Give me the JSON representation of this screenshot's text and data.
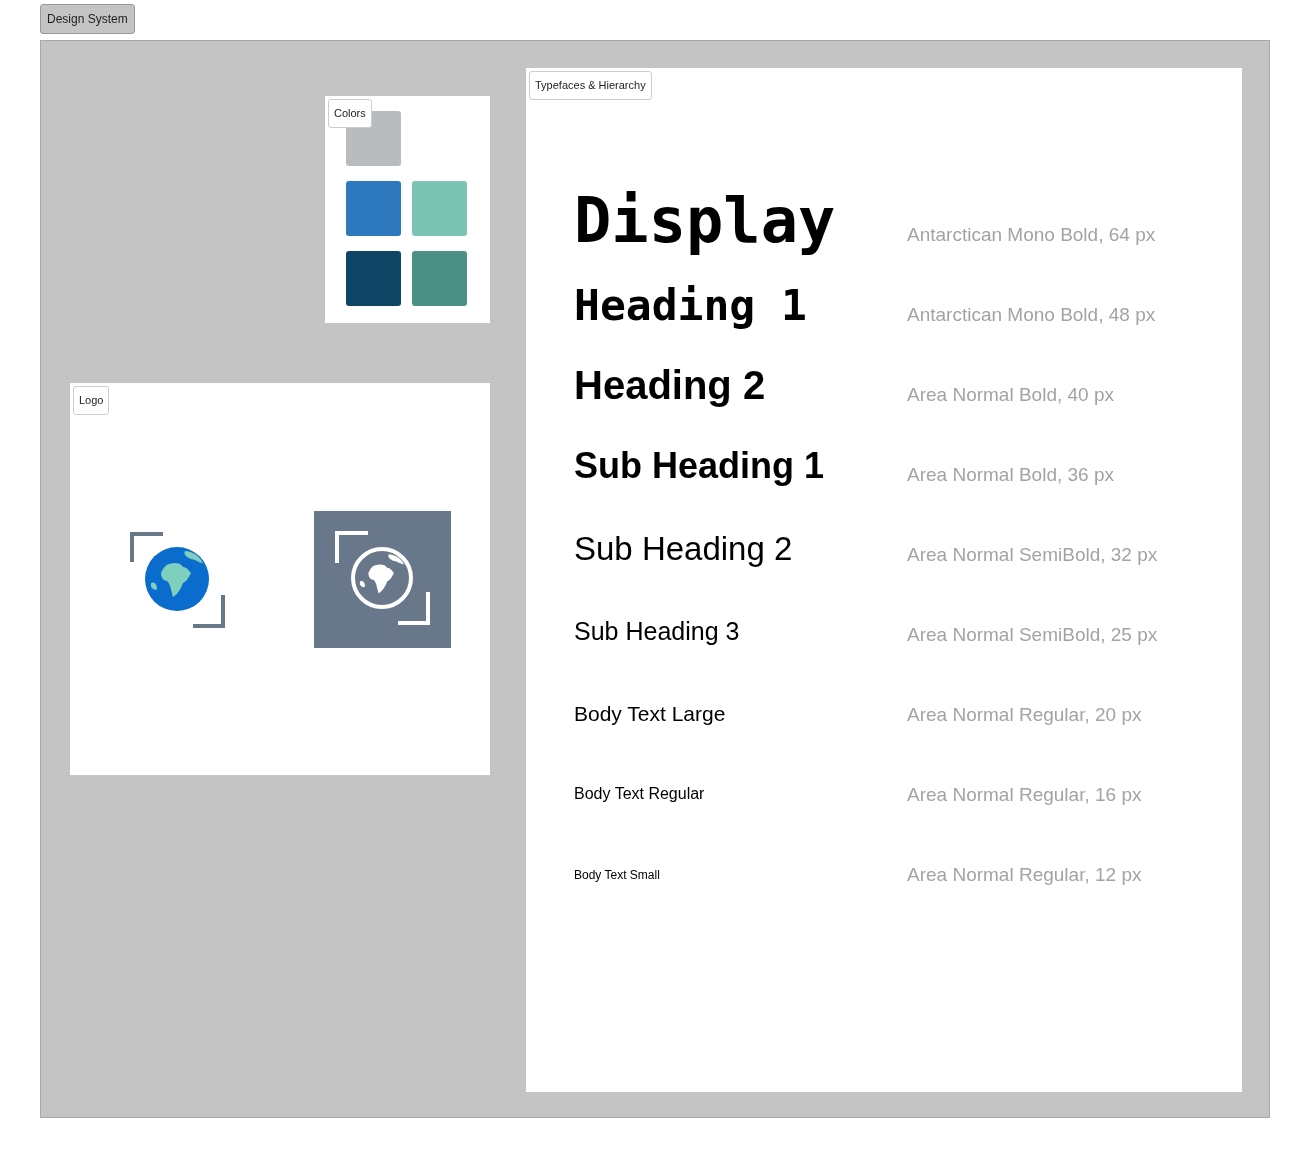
{
  "page_tab": "Design System",
  "frames": {
    "colors": {
      "label": "Colors",
      "swatches": [
        {
          "color": "#b9bcbf"
        },
        {
          "color": "#2e79bd"
        },
        {
          "color": "#7bc3b2"
        },
        {
          "color": "#0e4464"
        },
        {
          "color": "#4a9184"
        }
      ]
    },
    "logo": {
      "label": "Logo",
      "variants": [
        {
          "kind": "color"
        },
        {
          "kind": "inverse"
        }
      ]
    },
    "typefaces": {
      "label": "Typefaces & Hierarchy",
      "rows": [
        {
          "kind": "display",
          "sample": "Display",
          "spec": "Antarctican Mono Bold, 64 px"
        },
        {
          "kind": "heading_1",
          "sample": "Heading 1",
          "spec": "Antarctican Mono Bold, 48 px"
        },
        {
          "kind": "heading_2",
          "sample": "Heading 2",
          "spec": "Area Normal Bold, 40 px"
        },
        {
          "kind": "sub_heading_1",
          "sample": "Sub Heading 1",
          "spec": "Area Normal Bold, 36 px"
        },
        {
          "kind": "sub_heading_2",
          "sample": "Sub Heading 2",
          "spec": "Area Normal SemiBold, 32 px"
        },
        {
          "kind": "sub_heading_3",
          "sample": "Sub Heading 3",
          "spec": "Area Normal SemiBold, 25 px"
        },
        {
          "kind": "body_large",
          "sample": "Body Text Large",
          "spec": "Area Normal Regular, 20 px"
        },
        {
          "kind": "body_regular",
          "sample": "Body Text Regular",
          "spec": "Area Normal Regular, 16 px"
        },
        {
          "kind": "body_small",
          "sample": "Body Text Small",
          "spec": "Area Normal Regular, 12 px"
        }
      ]
    }
  }
}
